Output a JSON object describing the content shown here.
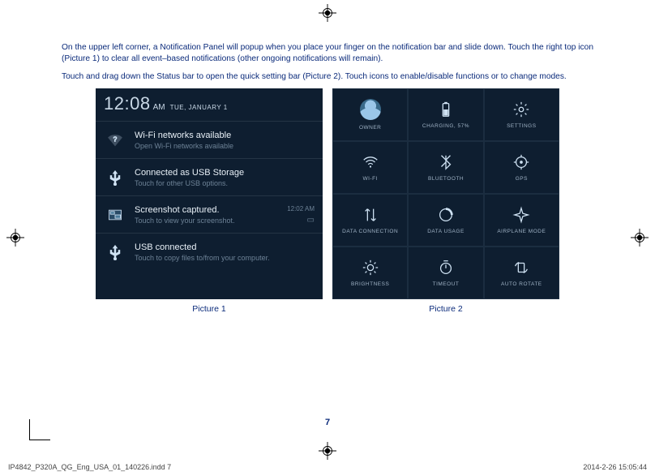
{
  "paragraphs": {
    "p1": "On the upper left corner, a Notification Panel will popup when you place your finger on the notification bar and slide down. Touch the right top icon (Picture 1) to clear all event–based notifications (other ongoing notifications will remain).",
    "p2": "Touch and drag down the Status bar to open the quick setting bar (Picture 2). Touch icons to enable/disable functions or to change modes."
  },
  "captions": {
    "pic1": "Picture 1",
    "pic2": "Picture 2"
  },
  "picture1": {
    "time": "12:08",
    "ampm": "AM",
    "date": "TUE, JANUARY 1",
    "rows": [
      {
        "title": "Wi-Fi networks available",
        "sub": "Open Wi-Fi networks available"
      },
      {
        "title": "Connected as USB Storage",
        "sub": "Touch for other USB options."
      },
      {
        "title": "Screenshot captured.",
        "sub": "Touch to view your screenshot.",
        "right_time": "12:02 AM"
      },
      {
        "title": "USB connected",
        "sub": "Touch to copy files to/from your computer."
      }
    ]
  },
  "picture2": {
    "tiles": [
      {
        "label": "OWNER"
      },
      {
        "label": "CHARGING, 57%"
      },
      {
        "label": "SETTINGS"
      },
      {
        "label": "WI-FI"
      },
      {
        "label": "BLUETOOTH"
      },
      {
        "label": "GPS"
      },
      {
        "label": "DATA CONNECTION"
      },
      {
        "label": "DATA USAGE"
      },
      {
        "label": "AIRPLANE MODE"
      },
      {
        "label": "BRIGHTNESS"
      },
      {
        "label": "TIMEOUT"
      },
      {
        "label": "AUTO ROTATE"
      }
    ]
  },
  "page_number": "7",
  "footer": {
    "left": "IP4842_P320A_QG_Eng_USA_01_140226.indd   7",
    "right": "2014-2-26   15:05:44"
  }
}
